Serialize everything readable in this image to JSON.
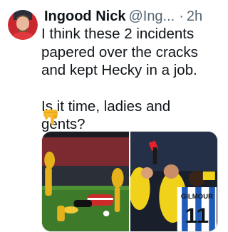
{
  "tweet": {
    "author_name": "Ingood Nick",
    "handle": "@Ing...",
    "separator": "·",
    "timestamp": "2h",
    "lines": [
      "I think these 2 incidents",
      "papered over the cracks",
      "and kept Hecky in a job."
    ],
    "question": "Is it time, ladies and gents?",
    "emoji_icon": "pointing-down-emoji",
    "media": [
      {
        "icon": "football-tackle-photo"
      },
      {
        "icon": "red-card-photo",
        "shirt_name": "GILMOUR",
        "shirt_number": "11"
      }
    ]
  },
  "colors": {
    "text": "#0f1419",
    "muted": "#536471",
    "pitch": "#3d7a2a",
    "red_card": "#e8202a",
    "stripe_blue": "#1f5bb8"
  }
}
